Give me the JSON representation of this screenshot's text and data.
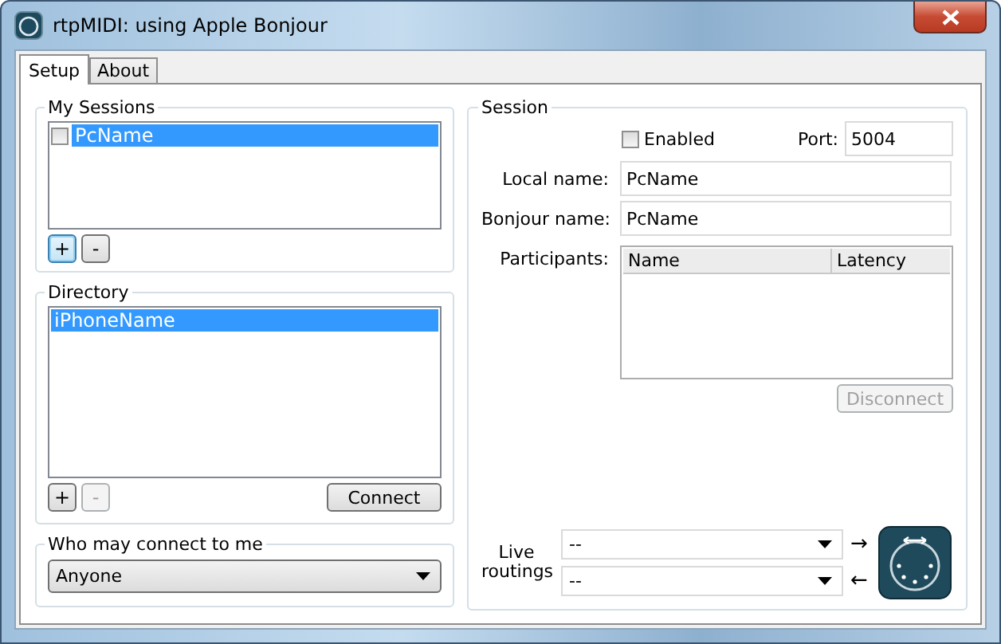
{
  "window": {
    "title": "rtpMIDI: using Apple Bonjour"
  },
  "tabs": [
    {
      "label": "Setup",
      "selected": true
    },
    {
      "label": "About",
      "selected": false
    }
  ],
  "my_sessions": {
    "title": "My Sessions",
    "items": [
      {
        "name": "PcName",
        "checked": false,
        "selected": true
      }
    ],
    "buttons": [
      {
        "label": "+",
        "disabled": false,
        "focused": true
      },
      {
        "label": "-",
        "disabled": false,
        "focused": false
      }
    ]
  },
  "directory": {
    "title": "Directory",
    "items": [
      {
        "name": "iPhoneName",
        "selected": true
      }
    ],
    "buttons": [
      {
        "label": "+",
        "disabled": false,
        "focused": false
      },
      {
        "label": "-",
        "disabled": true,
        "focused": false
      }
    ],
    "connect_button": {
      "label": "Connect",
      "disabled": false
    }
  },
  "who_may_connect": {
    "title": "Who may connect to me",
    "value": "Anyone"
  },
  "session": {
    "title": "Session",
    "enabled": {
      "label": "Enabled",
      "checked": false
    },
    "port": {
      "label": "Port:",
      "value": "5004"
    },
    "fields": [
      {
        "label": "Local name:",
        "value": "PcName"
      },
      {
        "label": "Bonjour name:",
        "value": "PcName"
      }
    ],
    "participants": {
      "label": "Participants:",
      "columns": [
        "Name",
        "Latency"
      ]
    },
    "disconnect_button": {
      "label": "Disconnect",
      "disabled": true
    }
  },
  "live_routings": {
    "label": "Live routings",
    "routes": [
      {
        "value": "--",
        "arrow": "→"
      },
      {
        "value": "--",
        "arrow": "←"
      }
    ]
  }
}
